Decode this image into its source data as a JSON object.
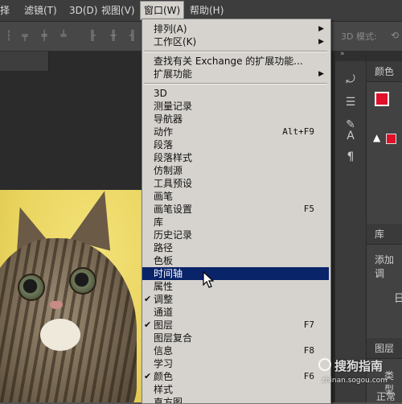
{
  "menubar": {
    "items": [
      "择",
      "滤镜(T)",
      "3D(D)",
      "视图(V)",
      "窗口(W)",
      "帮助(H)"
    ],
    "active_index": 4
  },
  "optionsbar": {
    "mode_label": "3D 模式:"
  },
  "panels": {
    "color_tab": "颜色",
    "library_tab": "库",
    "adjust_text": "添加调",
    "layers_tab": "图层",
    "kind_label": "类型",
    "normal_label": "正常",
    "partial_label": "日"
  },
  "window_menu": {
    "items": [
      {
        "label": "排列(A)",
        "submenu": true
      },
      {
        "label": "工作区(K)",
        "submenu": true
      },
      {
        "label": "查找有关 Exchange 的扩展功能..."
      },
      {
        "label": "扩展功能",
        "submenu": true
      },
      {
        "label": "3D"
      },
      {
        "label": "测量记录"
      },
      {
        "label": "导航器"
      },
      {
        "label": "动作",
        "shortcut": "Alt+F9"
      },
      {
        "label": "段落"
      },
      {
        "label": "段落样式"
      },
      {
        "label": "仿制源"
      },
      {
        "label": "工具预设"
      },
      {
        "label": "画笔"
      },
      {
        "label": "画笔设置",
        "shortcut": "F5"
      },
      {
        "label": "库"
      },
      {
        "label": "历史记录"
      },
      {
        "label": "路径"
      },
      {
        "label": "色板"
      },
      {
        "label": "时间轴",
        "highlighted": true
      },
      {
        "label": "属性"
      },
      {
        "label": "调整",
        "checked": true
      },
      {
        "label": "通道"
      },
      {
        "label": "图层",
        "checked": true,
        "shortcut": "F7"
      },
      {
        "label": "图层复合"
      },
      {
        "label": "信息",
        "shortcut": "F8"
      },
      {
        "label": "学习"
      },
      {
        "label": "颜色",
        "checked": true,
        "shortcut": "F6"
      },
      {
        "label": "样式"
      },
      {
        "label": "直方图"
      }
    ]
  },
  "watermark": {
    "brand": "搜狗指南",
    "url": "zhinan.sogou.com"
  },
  "colors": {
    "highlight": "#0a246a",
    "menu_bg": "#d6d3ce",
    "foreground_swatch": "#e0102a"
  },
  "icons": [
    "check-icon",
    "submenu-arrow-icon",
    "cursor-arrow-icon",
    "warning-icon",
    "paragraph-icon",
    "type-icon"
  ]
}
